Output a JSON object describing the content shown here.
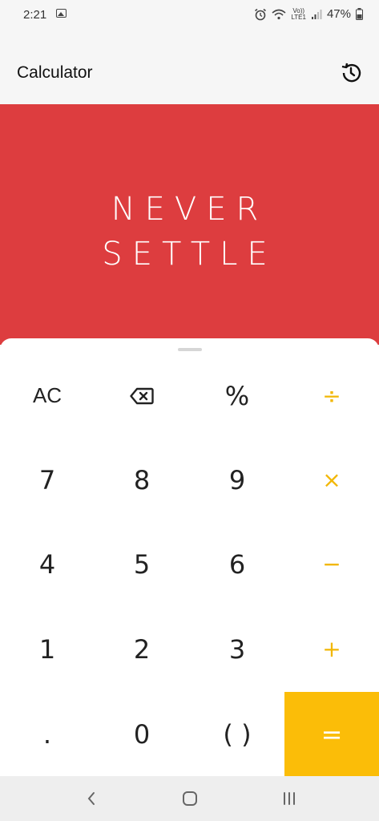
{
  "status_bar": {
    "time": "2:21",
    "network_top": "Vo))",
    "network_bottom": "LTE1",
    "battery": "47%"
  },
  "header": {
    "title": "Calculator",
    "history_icon": "history-icon"
  },
  "display": {
    "line1": "NEVER",
    "line2": "SETTLE",
    "background_color": "#dd3d3f"
  },
  "keypad": {
    "keys": [
      [
        "AC",
        "backspace",
        "%",
        "÷"
      ],
      [
        "7",
        "8",
        "9",
        "×"
      ],
      [
        "4",
        "5",
        "6",
        "−"
      ],
      [
        "1",
        "2",
        "3",
        "+"
      ],
      [
        ".",
        "0",
        "( )",
        "="
      ]
    ],
    "accent_color": "#fbbd08"
  },
  "nav_bar": {
    "back_icon": "back-icon",
    "home_icon": "home-icon",
    "recents_icon": "recents-icon"
  }
}
